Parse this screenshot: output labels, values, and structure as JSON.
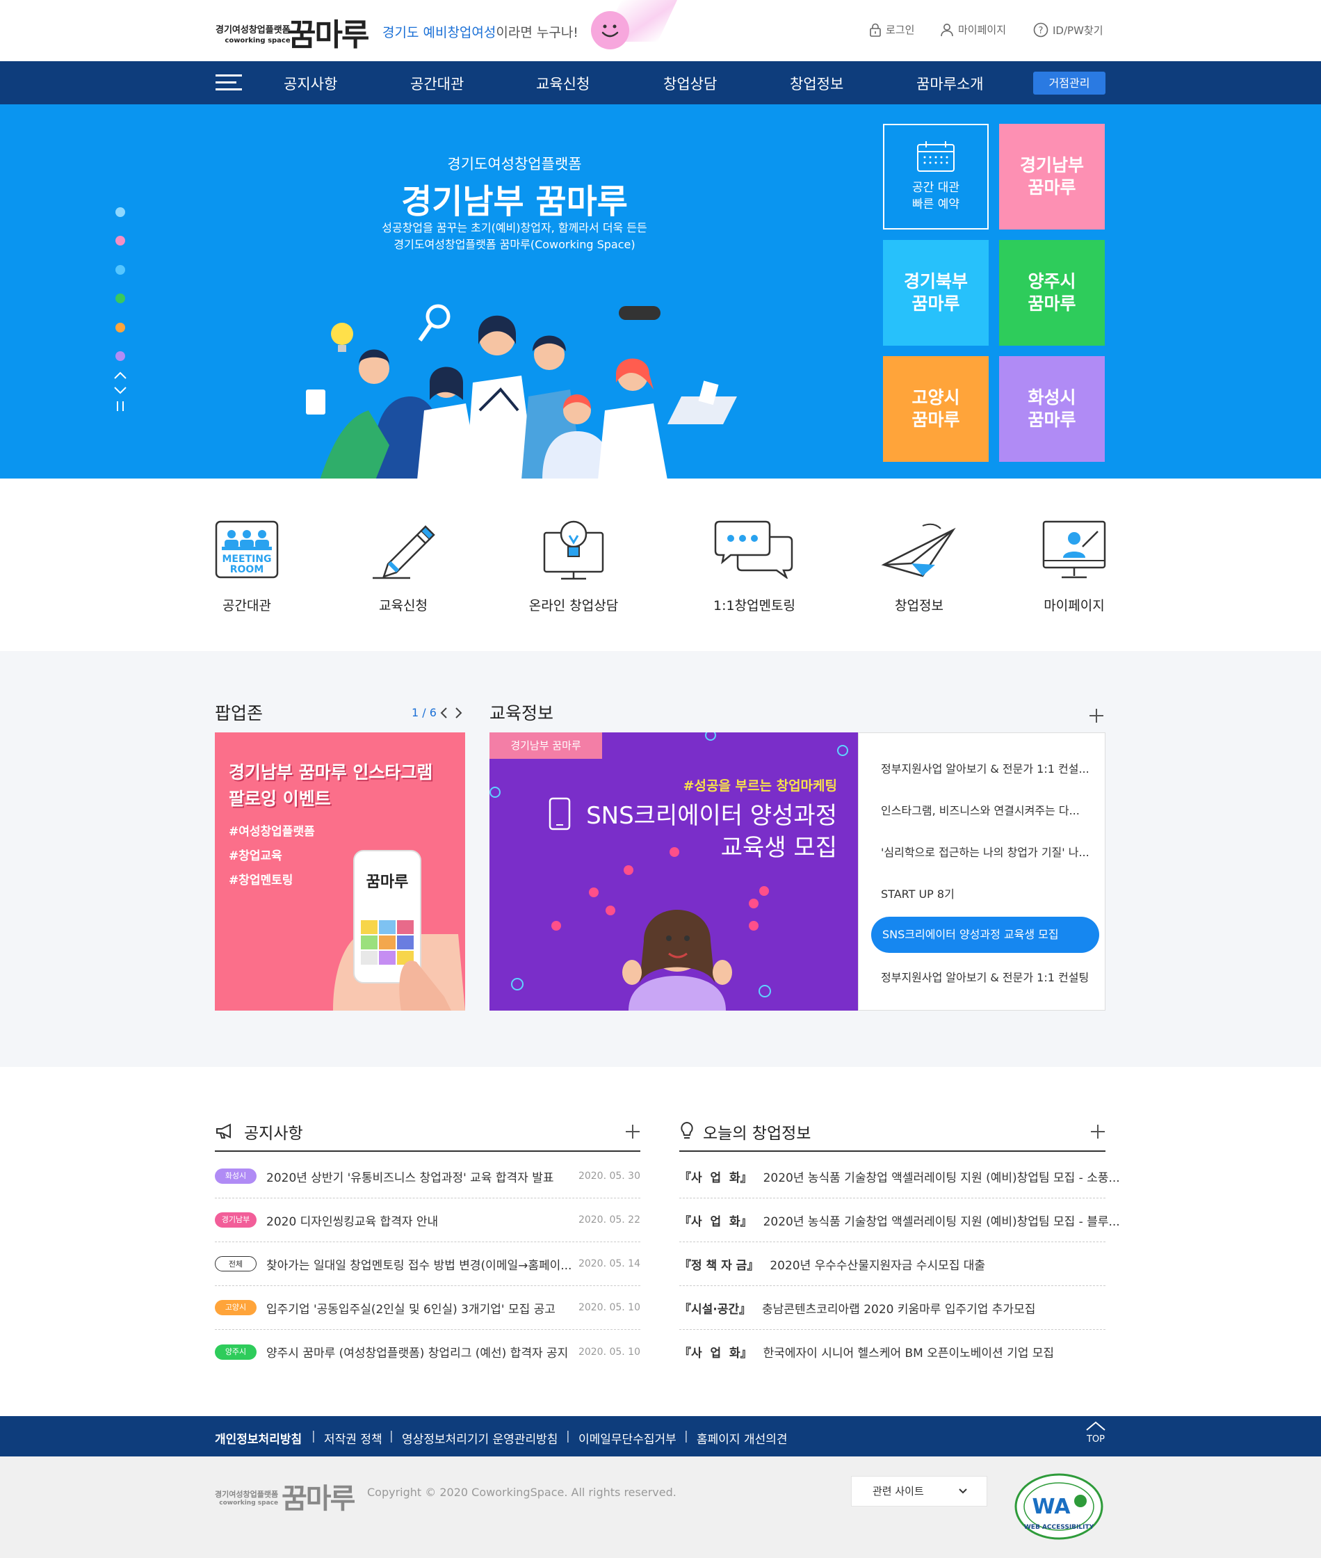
{
  "header": {
    "logo_small_line1": "경기여성창업플랫폼",
    "logo_small_line2": "coworking space",
    "logo_main": "꿈마루",
    "slogan_highlight": "경기도 예비창업여성",
    "slogan_rest": "이라면 누구나!",
    "util": {
      "login": "로그인",
      "mypage": "마이페이지",
      "find": "ID/PW찾기"
    }
  },
  "nav": {
    "items": [
      "공지사항",
      "공간대관",
      "교육신청",
      "창업상담",
      "창업정보",
      "꿈마루소개"
    ],
    "manage": "거점관리"
  },
  "hero": {
    "subtitle": "경기도여성창업플랫폼",
    "title": "경기남부 꿈마루",
    "desc_line1": "성공창업을 꿈꾸는 초기(예비)창업자, 함께라서 더욱 든든",
    "desc_line2": "경기도여성창업플랫폼 꿈마루(Coworking Space)",
    "dot_colors": [
      "#8fd8ff",
      "#f58fc4",
      "#55c6ff",
      "#3ac95c",
      "#ffa53c",
      "#b38cf5"
    ],
    "tiles": [
      {
        "line1": "공간 대관",
        "line2": "빠른 예약",
        "color": "#0a95f0"
      },
      {
        "line1": "경기남부",
        "line2": "꿈마루",
        "color": "#fd90b3"
      },
      {
        "line1": "경기북부",
        "line2": "꿈마루",
        "color": "#27c1fb"
      },
      {
        "line1": "양주시",
        "line2": "꿈마루",
        "color": "#2ecc5b"
      },
      {
        "line1": "고양시",
        "line2": "꿈마루",
        "color": "#ffa43a"
      },
      {
        "line1": "화성시",
        "line2": "꿈마루",
        "color": "#b08bf5"
      }
    ]
  },
  "quick": [
    {
      "label": "공간대관",
      "icon_text": "MEETING ROOM"
    },
    {
      "label": "교육신청"
    },
    {
      "label": "온라인 창업상담"
    },
    {
      "label": "1:1창업멘토링"
    },
    {
      "label": "창업정보"
    },
    {
      "label": "마이페이지"
    }
  ],
  "popup": {
    "title": "팝업존",
    "pager": "1 / 6",
    "banner_title1": "경기남부 꿈마루 인스타그램",
    "banner_title2": "팔로잉 이벤트",
    "tags": [
      "#여성창업플랫폼",
      "#창업교육",
      "#창업멘토링"
    ]
  },
  "edu": {
    "title": "교육정보",
    "banner_tag": "경기남부 꿈마루",
    "banner_kicker": "#성공을 부르는 창업마케팅",
    "banner_line1": "SNS크리에이터 양성과정",
    "banner_line2": "교육생 모집",
    "items": [
      "정부지원사업 알아보기 & 전문가 1:1 컨설...",
      "인스타그램, 비즈니스와 연결시켜주는 다...",
      "'심리학으로 접근하는 나의 창업가 기질' 나...",
      "START UP 8기",
      "SNS크리에이터 양성과정 교육생 모집",
      "정부지원사업 알아보기 & 전문가 1:1 컨설팅"
    ]
  },
  "notice": {
    "title": "공지사항",
    "rows": [
      {
        "badge": "화성시",
        "color": "#b08bf5",
        "text": "2020년 상반기 '유통비즈니스 창업과정' 교육 합격자 발표",
        "date": "2020. 05. 30"
      },
      {
        "badge": "경기남부",
        "color": "#f25e99",
        "text": "2020 디자인씽킹교육 합격자 안내",
        "date": "2020. 05. 22"
      },
      {
        "badge": "전체",
        "color": "#ffffff",
        "text": "찾아가는 일대일 창업멘토링 접수 방법 변경(이메일→홈페이...",
        "date": "2020. 05. 14"
      },
      {
        "badge": "고양시",
        "color": "#ffa43a",
        "text": "입주기업 '공동입주실(2인실 및 6인실) 3개기업' 모집 공고",
        "date": "2020. 05. 10"
      },
      {
        "badge": "양주시",
        "color": "#2ecc5b",
        "text": "양주시 꿈마루 (여성창업플랫폼) 창업리그 (예선) 합격자 공지",
        "date": "2020. 05. 10"
      }
    ]
  },
  "startup": {
    "title": "오늘의 창업정보",
    "rows": [
      {
        "cat": "『사  업  화』",
        "text": "2020년 농식품 기술창업 액셀러레이팅 지원 (예비)창업팀 모집 - 소풍..."
      },
      {
        "cat": "『사  업  화』",
        "text": "2020년 농식품 기술창업 액셀러레이팅 지원 (예비)창업팀 모집 - 블루..."
      },
      {
        "cat": "『정 책 자 금』",
        "text": "2020년 우수수산물지원자금 수시모집 대출"
      },
      {
        "cat": "『시설·공간』",
        "text": "충남콘텐츠코리아랩 2020 키움마루 입주기업 추가모집"
      },
      {
        "cat": "『사  업  화』",
        "text": "한국에자이 시니어 헬스케어 BM 오픈이노베이션 기업 모집"
      }
    ]
  },
  "footer": {
    "links": [
      "개인정보처리방침",
      "저작권 정책",
      "영상정보처리기기 운영관리방침",
      "이메일무단수집거부",
      "홈페이지 개선의견"
    ],
    "top": "TOP",
    "copyright": "Copyright © 2020 CoworkingSpace. All rights reserved.",
    "related": "관련 사이트",
    "wa_text": "WEB ACCESSIBILITY"
  }
}
